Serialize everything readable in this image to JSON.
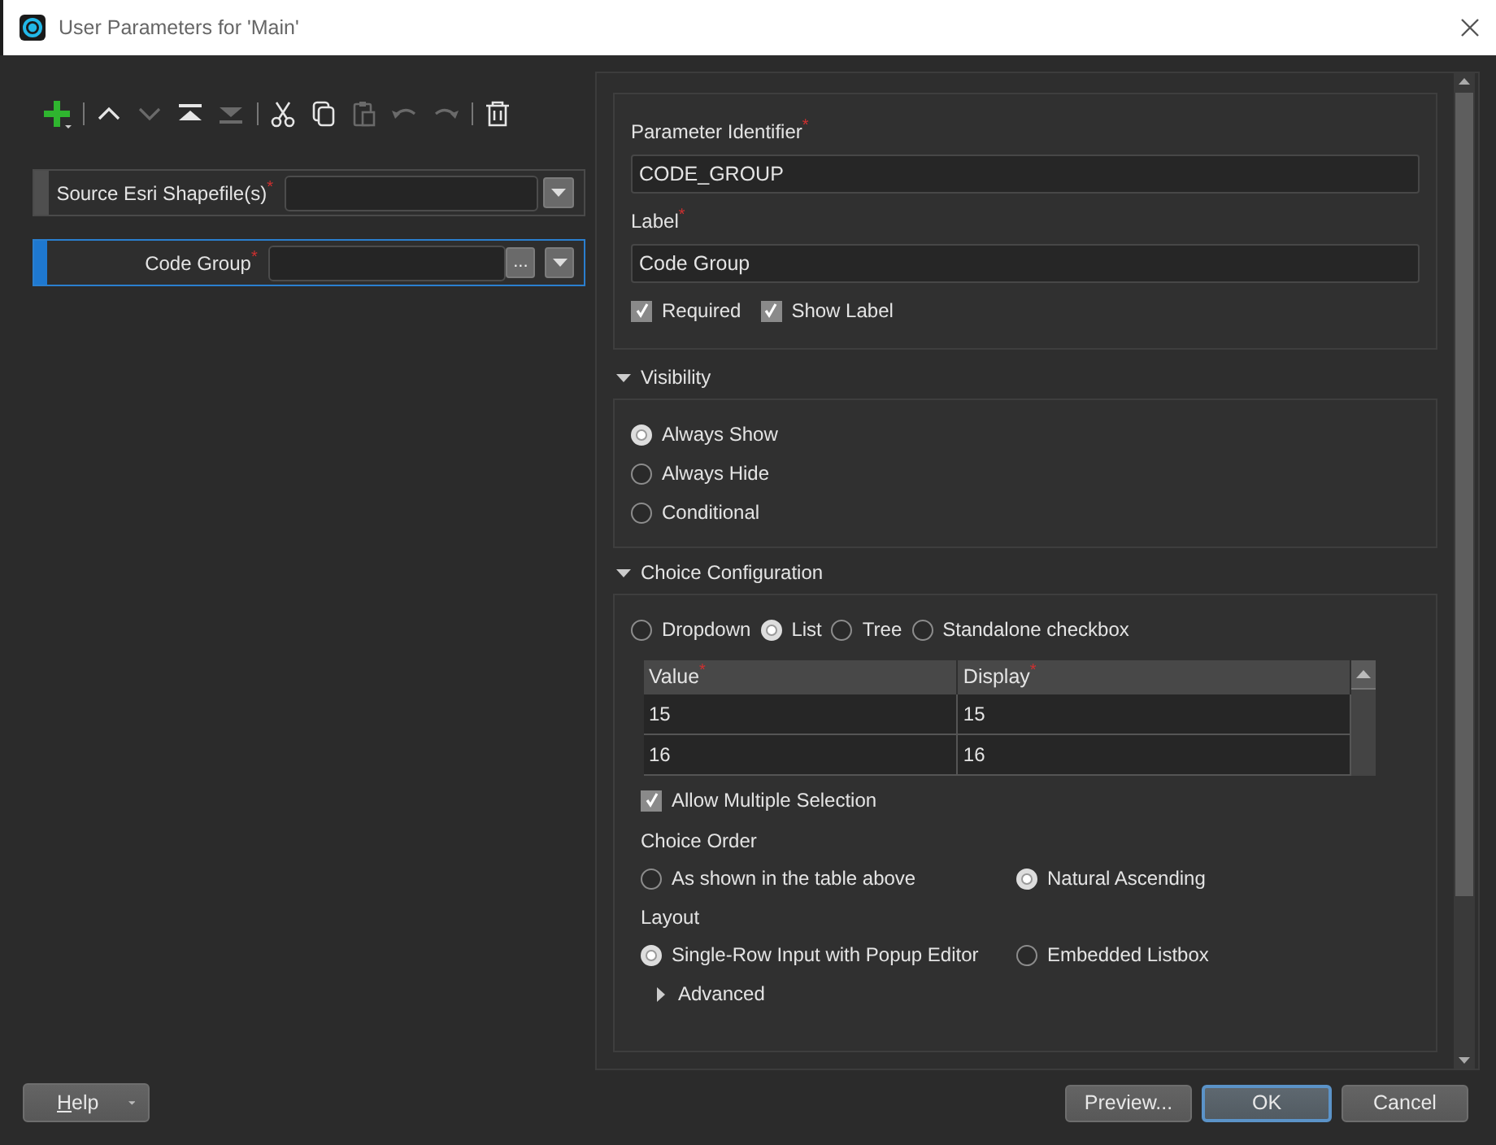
{
  "window": {
    "title": "User Parameters for 'Main'"
  },
  "toolbar": [
    {
      "kind": "add",
      "disabled": false
    },
    {
      "kind": "separator"
    },
    {
      "kind": "up",
      "disabled": false
    },
    {
      "kind": "down",
      "disabled": true
    },
    {
      "kind": "top",
      "disabled": false
    },
    {
      "kind": "bottom",
      "disabled": true
    },
    {
      "kind": "separator"
    },
    {
      "kind": "cut",
      "disabled": false
    },
    {
      "kind": "copy",
      "disabled": false
    },
    {
      "kind": "paste",
      "disabled": true
    },
    {
      "kind": "undo",
      "disabled": true
    },
    {
      "kind": "redo",
      "disabled": true
    },
    {
      "kind": "separator"
    },
    {
      "kind": "delete",
      "disabled": false
    }
  ],
  "parameters": [
    {
      "label": "Source Esri Shapefile(s)$^{*}$",
      "selected": false
    },
    {
      "label": "Code Group$^{*}$",
      "selected": true,
      "browse_label": "..."
    }
  ],
  "properties": {
    "identifier_label": "Parameter Identifier$^{*}$",
    "identifier_value": "CODE_GROUP",
    "label_label": "Label$^{*}$",
    "label_value": "Code Group",
    "checkboxes": [
      {
        "label": "Required",
        "checked": true
      },
      {
        "label": "Show Label",
        "checked": true
      }
    ]
  },
  "visibility": {
    "title": "Visibility",
    "expanded": true,
    "options": [
      {
        "label": "Always Show",
        "selected": true
      },
      {
        "label": "Always Hide",
        "selected": false
      },
      {
        "label": "Conditional",
        "selected": false
      }
    ]
  },
  "choice_configuration": {
    "title": "Choice Configuration",
    "expanded": true,
    "types": [
      {
        "label": "Dropdown",
        "selected": false
      },
      {
        "label": "List",
        "selected": true
      },
      {
        "label": "Tree",
        "selected": false
      },
      {
        "label": "Standalone checkbox",
        "selected": false
      }
    ],
    "table": {
      "columns": [
        "Value$^{*}$",
        "Display$^{*}$"
      ],
      "rows": [
        [
          "15",
          "15"
        ],
        [
          "16",
          "16"
        ]
      ]
    },
    "allow_multiple": {
      "label": "Allow Multiple Selection",
      "checked": true
    },
    "choice_order": {
      "title": "Choice Order",
      "options": [
        {
          "label": "As shown in the table above",
          "selected": false
        },
        {
          "label": "Natural Ascending",
          "selected": true
        }
      ]
    },
    "layout": {
      "title": "Layout",
      "options": [
        {
          "label": "Single-Row Input with Popup Editor",
          "selected": true
        },
        {
          "label": "Embedded Listbox",
          "selected": false
        }
      ]
    },
    "advanced": {
      "label": "Advanced",
      "expanded": false
    }
  },
  "help_button": "Help",
  "buttons": [
    {
      "label": "Preview...",
      "default": false
    },
    {
      "label": "OK",
      "default": true
    },
    {
      "label": "Cancel",
      "default": false
    }
  ]
}
